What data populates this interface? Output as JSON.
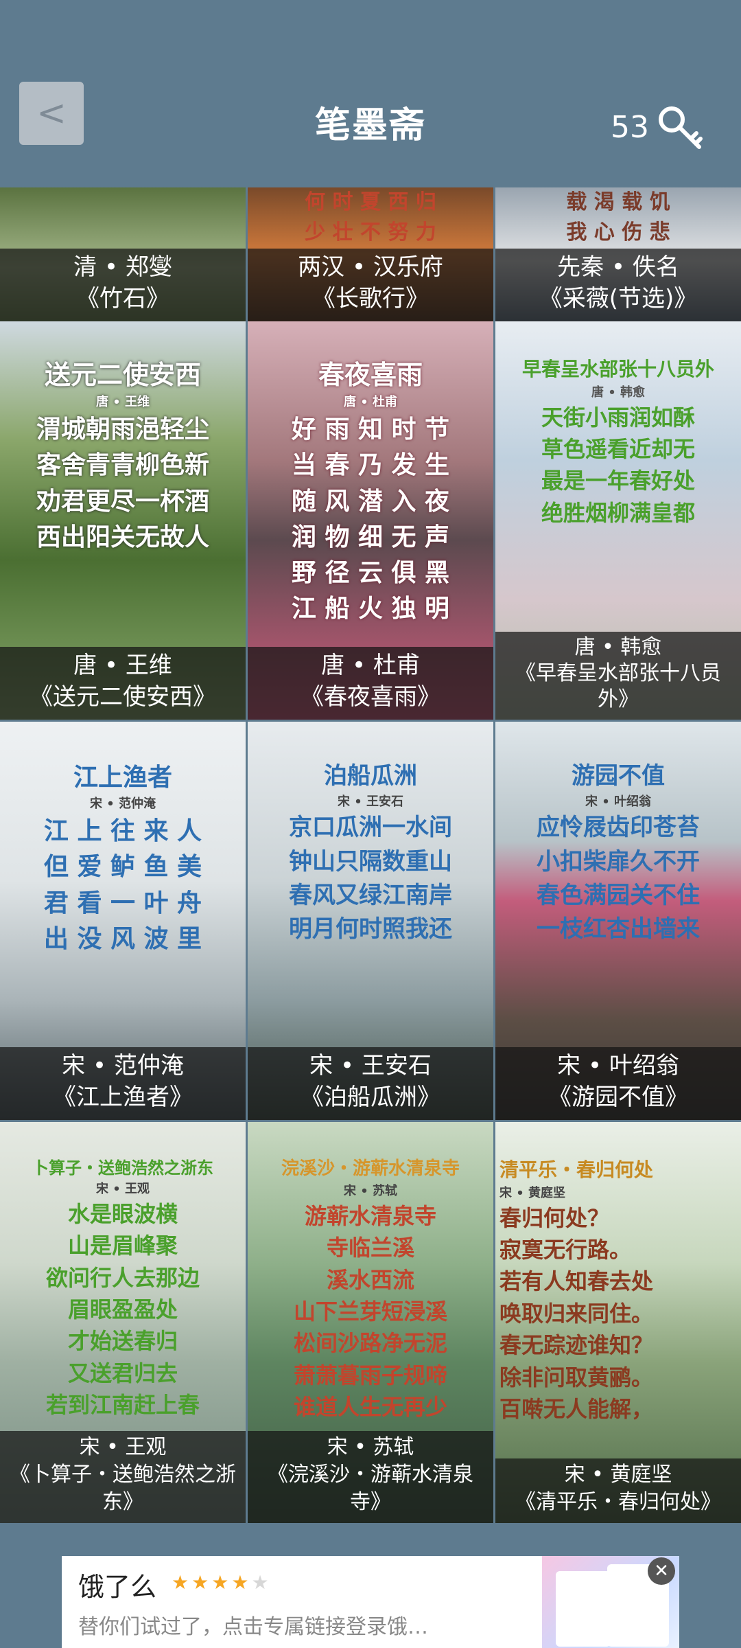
{
  "header": {
    "back_label": "<",
    "title": "笔墨斋",
    "count": "53"
  },
  "rows": [
    [
      {
        "author": "清 • 郑燮",
        "work": "《竹石》",
        "poem_title": "",
        "poem_lines": [
          "",
          ""
        ]
      },
      {
        "author": "两汉 • 汉乐府",
        "work": "《长歌行》",
        "poem_title": "",
        "poem_lines": [
          "何 时 夏 西 归",
          "少 壮 不 努 力"
        ]
      },
      {
        "author": "先秦 • 佚名",
        "work": "《采薇(节选)》",
        "poem_title": "",
        "poem_lines": [
          "载 渴 载 饥",
          "我 心 伤 悲"
        ]
      }
    ],
    [
      {
        "author": "唐 • 王维",
        "work": "《送元二使安西》",
        "poem_title": "送元二使安西",
        "poem_sub": "唐 • 王维",
        "poem_lines": [
          "渭城朝雨浥轻尘",
          "客舍青青柳色新",
          "劝君更尽一杯酒",
          "西出阳关无故人"
        ]
      },
      {
        "author": "唐 • 杜甫",
        "work": "《春夜喜雨》",
        "poem_title": "春夜喜雨",
        "poem_sub": "唐 • 杜甫",
        "poem_lines": [
          "好 雨 知 时 节",
          "当 春 乃 发 生",
          "随 风 潜 入 夜",
          "润 物 细 无 声",
          "野 径 云 俱 黑",
          "江 船 火 独 明"
        ]
      },
      {
        "author": "唐 • 韩愈",
        "work": "《早春呈水部张十八员外》",
        "poem_title": "早春呈水部张十八员外",
        "poem_sub": "唐 • 韩愈",
        "poem_lines": [
          "天街小雨润如酥",
          "草色遥看近却无",
          "最是一年春好处",
          "绝胜烟柳满皇都"
        ]
      }
    ],
    [
      {
        "author": "宋 • 范仲淹",
        "work": "《江上渔者》",
        "poem_title": "江上渔者",
        "poem_sub": "宋 • 范仲淹",
        "poem_lines": [
          "江 上 往 来 人",
          "但 爱 鲈 鱼 美",
          "君 看 一 叶 舟",
          "出 没 风 波 里"
        ]
      },
      {
        "author": "宋 • 王安石",
        "work": "《泊船瓜洲》",
        "poem_title": "泊船瓜洲",
        "poem_sub": "宋 • 王安石",
        "poem_lines": [
          "京口瓜洲一水间",
          "钟山只隔数重山",
          "春风又绿江南岸",
          "明月何时照我还"
        ]
      },
      {
        "author": "宋 • 叶绍翁",
        "work": "《游园不值》",
        "poem_title": "游园不值",
        "poem_sub": "宋 • 叶绍翁",
        "poem_lines": [
          "应怜屐齿印苍苔",
          "小扣柴扉久不开",
          "春色满园关不住",
          "一枝红杏出墙来"
        ]
      }
    ],
    [
      {
        "author": "宋 • 王观",
        "work": "《卜算子・送鲍浩然之浙东》",
        "poem_title": "卜算子・送鲍浩然之浙东",
        "poem_sub": "宋 • 王观",
        "poem_lines": [
          "水是眼波横",
          "山是眉峰聚",
          "欲问行人去那边",
          "眉眼盈盈处",
          "才始送春归",
          "又送君归去",
          "若到江南赶上春"
        ]
      },
      {
        "author": "宋 • 苏轼",
        "work": "《浣溪沙・游蕲水清泉寺》",
        "poem_title": "浣溪沙・游蕲水清泉寺",
        "poem_sub": "宋 • 苏轼",
        "poem_lines": [
          "游蕲水清泉寺",
          "寺临兰溪",
          "溪水西流",
          "山下兰芽短浸溪",
          "松间沙路净无泥",
          "萧萧暮雨子规啼",
          "谁道人生无再少"
        ]
      },
      {
        "author": "宋 • 黄庭坚",
        "work": "《清平乐・春归何处》",
        "poem_title": "清平乐・春归何处",
        "poem_sub": "宋 • 黄庭坚",
        "poem_lines": [
          "春归何处？",
          "寂寞无行路。",
          "若有人知春去处",
          "唤取归来同住。",
          "春无踪迹谁知？",
          "除非问取黄鹂。",
          "百啭无人能解，"
        ]
      }
    ]
  ],
  "ad": {
    "title": "饿了么",
    "subtitle": "替你们试过了，点击专属链接登录饿…",
    "close_label": "✕",
    "rating": 4,
    "rating_max": 5
  },
  "colors": {
    "background": "#5e7b8f",
    "green_text": "#4aa02c",
    "red_text": "#c2452d",
    "blue_text": "#2e6fb2"
  }
}
